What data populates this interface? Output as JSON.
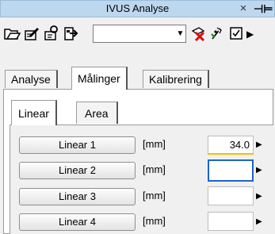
{
  "window": {
    "title": "IVUS Analyse",
    "close_glyph": "×",
    "pin_glyph": "⊣⊨"
  },
  "toolbar": {
    "icons": [
      "open-folder-icon",
      "edit-icon",
      "settings-icon",
      "export-icon",
      "delete-icon",
      "measure-icon",
      "checkbox-icon",
      "more-arrow-icon"
    ],
    "combo_value": "",
    "combo_arrow": "▼",
    "more_arrow": "▶"
  },
  "tabs": [
    "Analyse",
    "Målinger",
    "Kalibrering"
  ],
  "subtabs": [
    "Linear",
    "Area"
  ],
  "measurements": [
    {
      "label": "Linear 1",
      "unit": "[mm]",
      "value": "34.0"
    },
    {
      "label": "Linear 2",
      "unit": "[mm]",
      "value": ""
    },
    {
      "label": "Linear 3",
      "unit": "[mm]",
      "value": ""
    },
    {
      "label": "Linear 4",
      "unit": "[mm]",
      "value": ""
    }
  ],
  "row_arrow": "▶",
  "colors": {
    "title_bar": "#bdd7ee",
    "focus_border": "#1d64d0",
    "value_underline": "#f2c200",
    "delete_red": "#d21010"
  }
}
